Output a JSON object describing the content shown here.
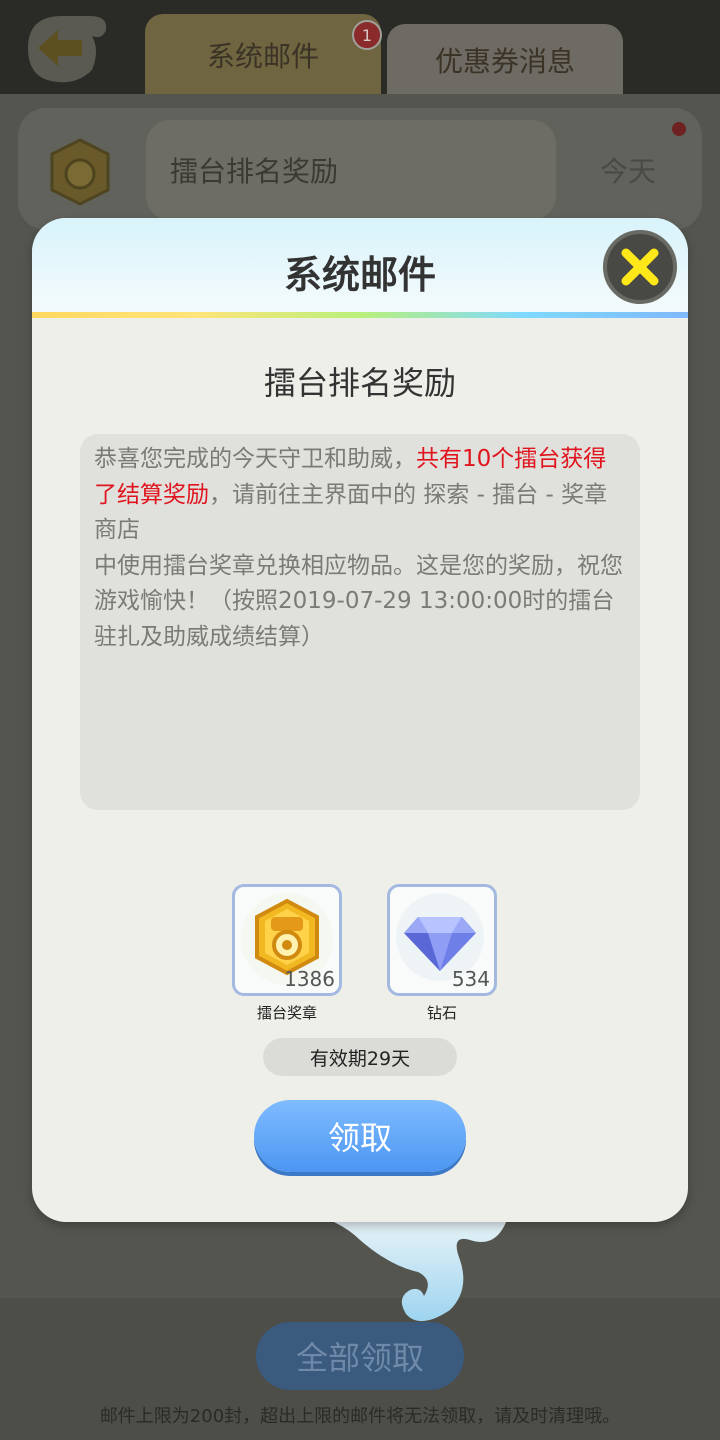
{
  "header": {
    "tabs": [
      {
        "label": "系统邮件",
        "badge": "1",
        "active": true
      },
      {
        "label": "优惠券消息",
        "active": false
      }
    ]
  },
  "mail_list": {
    "items": [
      {
        "title": "擂台排名奖励",
        "date": "今天",
        "icon": "medal-icon",
        "unread": true
      }
    ]
  },
  "footer": {
    "claim_all_label": "全部领取",
    "limit_note": "邮件上限为200封，超出上限的邮件将无法领取，请及时清理哦。"
  },
  "dialog": {
    "title": "系统邮件",
    "mail_title": "擂台排名奖励",
    "body_part1": "恭喜您完成的今天守卫和助威，",
    "body_highlight": "共有10个擂台获得了结算奖励",
    "body_part2": "，请前往主界面中的 探索 - 擂台 - 奖章商店",
    "body_part3": "中使用擂台奖章兑换相应物品。这是您的奖励，祝您游戏愉快！（按照2019-07-29 13:00:00时的擂台驻扎及助威成绩结算）",
    "rewards": [
      {
        "name": "擂台奖章",
        "count": "1386",
        "icon": "medal-icon"
      },
      {
        "name": "钻石",
        "count": "534",
        "icon": "diamond-icon"
      }
    ],
    "validity": "有效期29天",
    "claim_label": "领取"
  },
  "colors": {
    "highlight": "#e0141e",
    "claim_button": "#4c96f2",
    "tab_active": "#6f6540"
  }
}
